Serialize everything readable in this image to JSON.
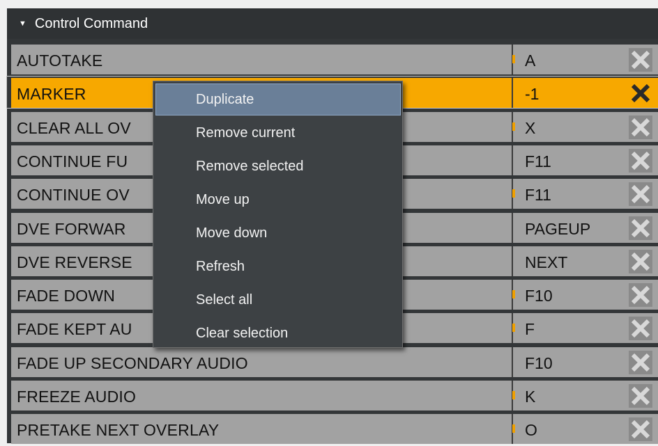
{
  "panel": {
    "title": "Control Command",
    "rows": [
      {
        "name": "AUTOTAKE",
        "key": "A",
        "tick": true,
        "selected": false
      },
      {
        "name": "MARKER",
        "key": "-1",
        "tick": false,
        "selected": true
      },
      {
        "name": "CLEAR ALL OV",
        "key": "X",
        "tick": true,
        "selected": false
      },
      {
        "name": "CONTINUE FU",
        "key": "F11",
        "tick": false,
        "selected": false
      },
      {
        "name": "CONTINUE OV",
        "key": "F11",
        "tick": true,
        "selected": false
      },
      {
        "name": "DVE FORWAR",
        "key": "PAGEUP",
        "tick": false,
        "selected": false
      },
      {
        "name": "DVE REVERSE",
        "key": "NEXT",
        "tick": false,
        "selected": false
      },
      {
        "name": "FADE DOWN",
        "key": "F10",
        "tick": true,
        "selected": false
      },
      {
        "name": "FADE KEPT AU",
        "key": "F",
        "tick": true,
        "selected": false
      },
      {
        "name": "FADE UP SECONDARY AUDIO",
        "key": "F10",
        "tick": false,
        "selected": false
      },
      {
        "name": "FREEZE AUDIO",
        "key": "K",
        "tick": true,
        "selected": false
      },
      {
        "name": "PRETAKE NEXT OVERLAY",
        "key": "O",
        "tick": true,
        "selected": false
      }
    ]
  },
  "context_menu": {
    "items": [
      {
        "label": "Duplicate",
        "highlighted": true
      },
      {
        "label": "Remove current",
        "highlighted": false
      },
      {
        "label": "Remove selected",
        "highlighted": false
      },
      {
        "label": "Move up",
        "highlighted": false
      },
      {
        "label": "Move down",
        "highlighted": false
      },
      {
        "label": "Refresh",
        "highlighted": false
      },
      {
        "label": "Select all",
        "highlighted": false
      },
      {
        "label": "Clear selection",
        "highlighted": false
      }
    ]
  },
  "colors": {
    "panel_bg": "#333638",
    "row_bg": "#a2a2a2",
    "selected_row": "#f7a800",
    "tick": "#f0a000",
    "menu_bg": "#3d4144",
    "menu_highlight": "#6a7f98"
  },
  "icons": {
    "collapse": "triangle-down-icon",
    "delete": "close-icon"
  }
}
